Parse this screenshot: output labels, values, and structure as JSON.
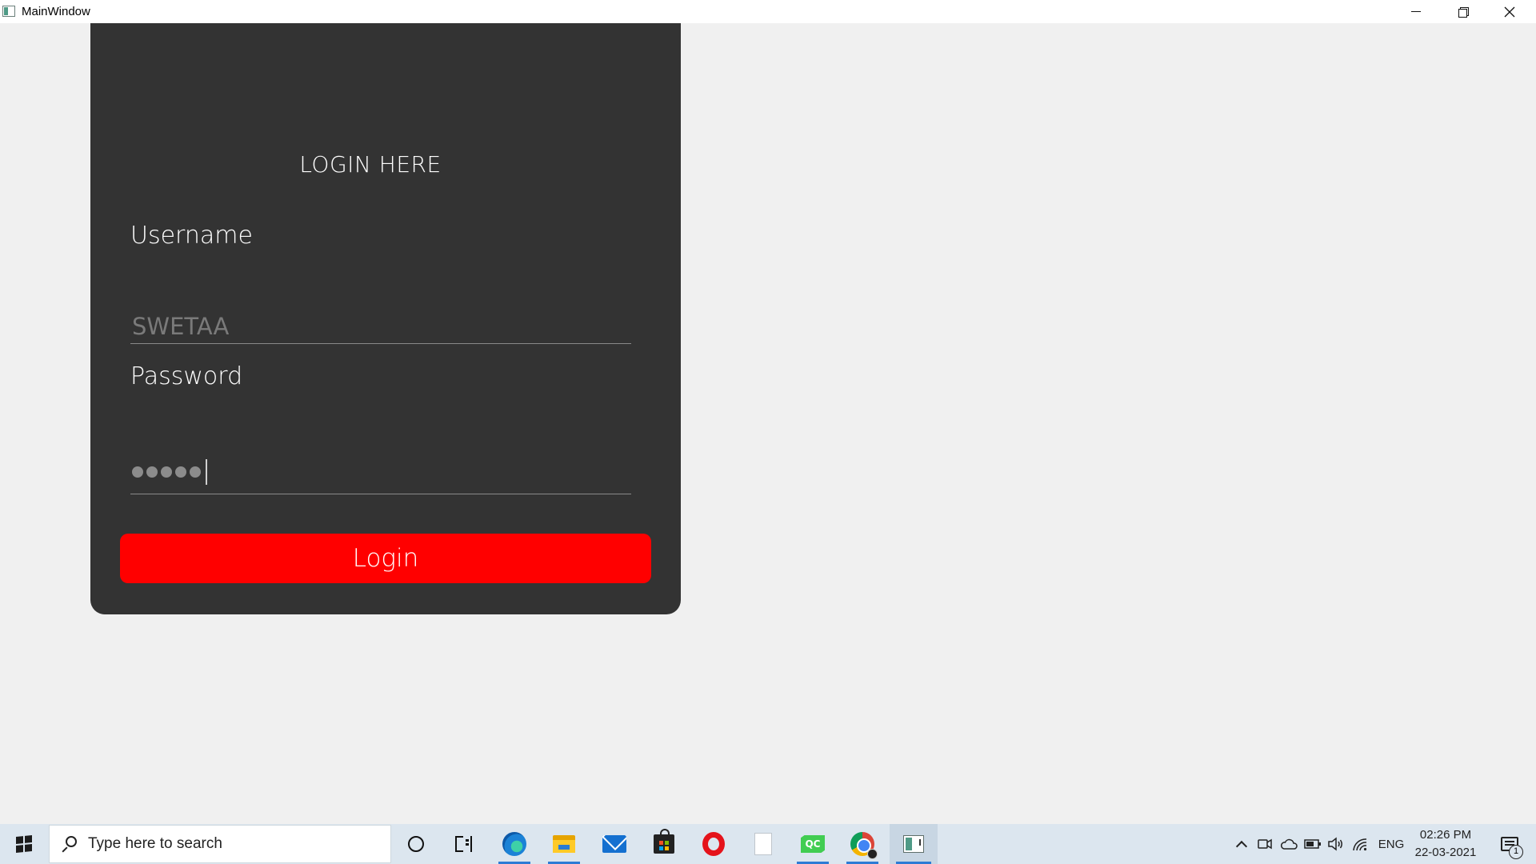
{
  "window": {
    "title": "MainWindow",
    "controls": [
      "minimize",
      "restore",
      "close"
    ]
  },
  "login": {
    "heading": "LOGIN HERE",
    "username_label": "Username",
    "username_value": "SWETAA",
    "password_label": "Password",
    "password_masked_length": 5,
    "login_button": "Login"
  },
  "colors": {
    "panel_bg": "#333333",
    "button_bg": "#ff0000",
    "window_bg": "#f0f0f0",
    "taskbar_bg": "#dce6ef"
  },
  "taskbar": {
    "search_placeholder": "Type here to search",
    "pinned_apps": [
      "cortana",
      "task-view",
      "edge",
      "file-explorer",
      "mail",
      "microsoft-store",
      "opera",
      "document",
      "qt-creator",
      "chrome",
      "mainwindow-app"
    ],
    "tray": {
      "language": "ENG",
      "time": "02:26 PM",
      "date": "22-03-2021",
      "notification_count": "1"
    }
  }
}
